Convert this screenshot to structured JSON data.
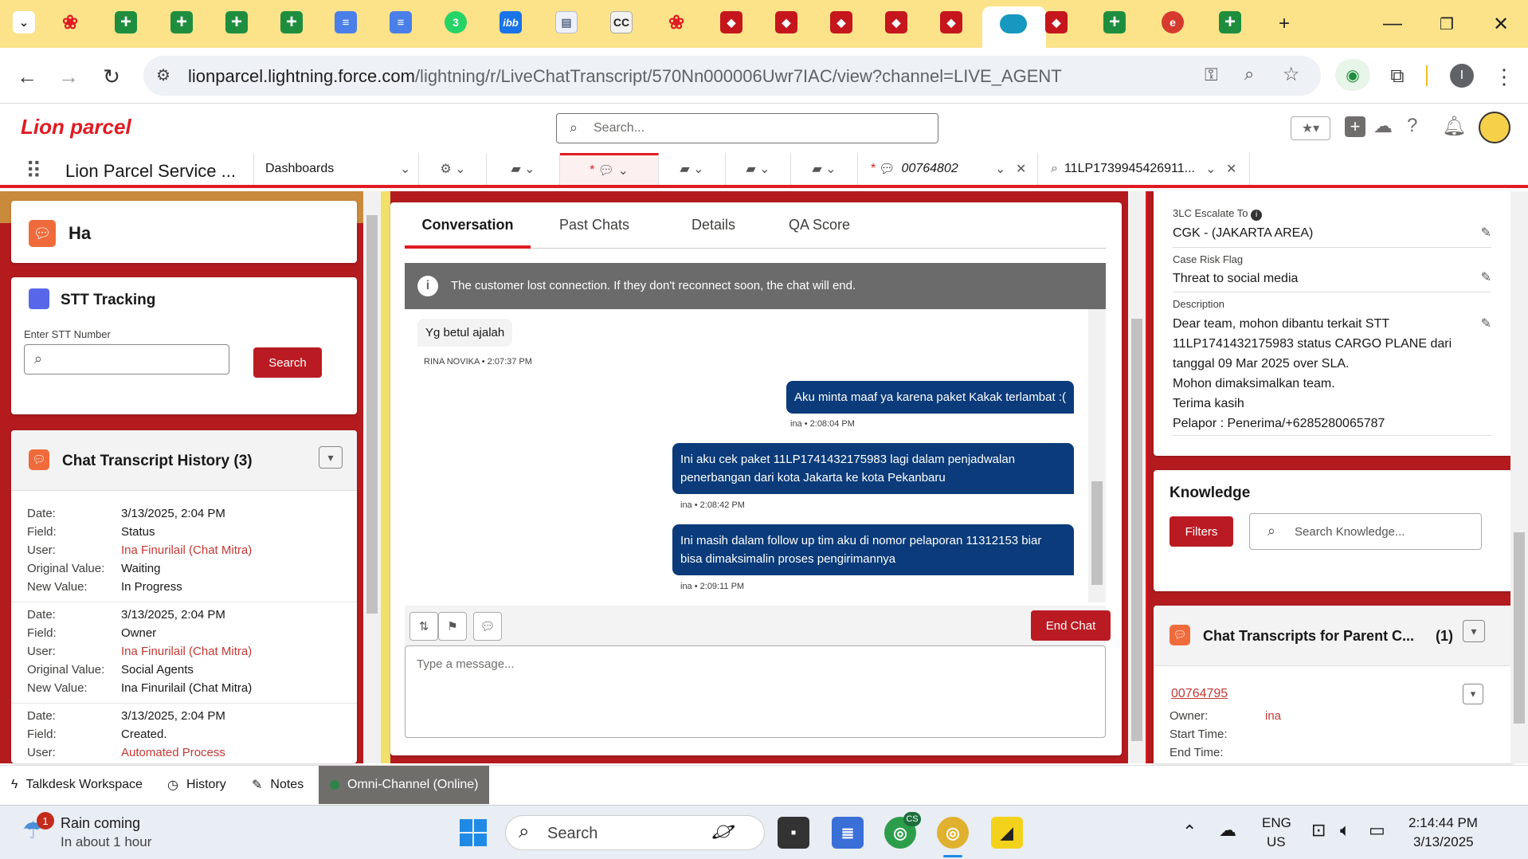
{
  "browser": {
    "url_host": "lionparcel.lightning.force.com",
    "url_path": "/lightning/r/LiveChatTranscript/570Nn000006Uwr7IAC/view?channel=LIVE_AGENT",
    "tab_glyphs": {
      "whatsapp": "3",
      "ibb": "ibb",
      "cc": "CC"
    }
  },
  "sf": {
    "logo": "Lion parcel",
    "search_placeholder": "Search...",
    "app_name": "Lion Parcel Service ...",
    "nav": {
      "dashboards": "Dashboards",
      "chat_tab_prefix": "*",
      "chat_tab_label": "00764802",
      "search_tab_label": "11LP1739945426911..."
    }
  },
  "left": {
    "ha_title": "Ha",
    "stt": {
      "title": "STT Tracking",
      "input_label": "Enter STT Number",
      "input_value": "",
      "search_button": "Search"
    },
    "history": {
      "title": "Chat Transcript History (3)",
      "labels": {
        "date": "Date:",
        "field": "Field:",
        "user": "User:",
        "orig": "Original Value:",
        "new": "New Value:"
      },
      "entries": [
        {
          "date": "3/13/2025, 2:04 PM",
          "field": "Status",
          "user": "Ina Finurilail (Chat Mitra)",
          "orig": "Waiting",
          "new": "In Progress"
        },
        {
          "date": "3/13/2025, 2:04 PM",
          "field": "Owner",
          "user": "Ina Finurilail (Chat Mitra)",
          "orig": "Social Agents",
          "new": "Ina Finurilail (Chat Mitra)"
        },
        {
          "date": "3/13/2025, 2:04 PM",
          "field": "Created.",
          "user": "Automated Process"
        }
      ]
    }
  },
  "center": {
    "tabs": [
      "Conversation",
      "Past Chats",
      "Details",
      "QA Score"
    ],
    "active_tab": "Conversation",
    "banner": "The customer lost connection. If they don't reconnect soon, the chat will end.",
    "messages": [
      {
        "dir": "in",
        "text": "Yg betul ajalah",
        "meta": "RINA NOVIKA • 2:07:37 PM"
      },
      {
        "dir": "out",
        "text": "Aku minta maaf ya karena paket Kakak terlambat :(",
        "meta": "ina • 2:08:04 PM"
      },
      {
        "dir": "out",
        "text": "Ini aku cek paket 11LP1741432175983 lagi dalam penjadwalan penerbangan dari kota Jakarta ke kota Pekanbaru",
        "meta": "ina • 2:08:42 PM"
      },
      {
        "dir": "out",
        "text": "Ini masih dalam follow up tim aku di nomor pelaporan 11312153 biar bisa dimaksimalin proses pengirimannya",
        "meta": "ina • 2:09:11 PM"
      }
    ],
    "end_chat": "End Chat",
    "composer_placeholder": "Type a message..."
  },
  "right": {
    "fields": [
      {
        "label": "3LC Escalate To",
        "value": "CGK - (JAKARTA AREA)"
      },
      {
        "label": "Case Risk Flag",
        "value": "Threat to social media"
      },
      {
        "label": "Description",
        "lines": [
          "Dear team, mohon dibantu terkait STT",
          "11LP1741432175983 status CARGO PLANE dari",
          "tanggal 09 Mar 2025 over SLA.",
          "Mohon dimaksimalkan team.",
          "Terima kasih",
          "Pelapor : Penerima/+6285280065787"
        ]
      }
    ],
    "knowledge": {
      "title": "Knowledge",
      "filters": "Filters",
      "search_placeholder": "Search Knowledge..."
    },
    "parent": {
      "title": "Chat Transcripts for Parent C...",
      "count": "(1)",
      "record": "00764795",
      "owner_label": "Owner:",
      "owner": "ina",
      "start_label": "Start Time:",
      "end_label": "End Time:"
    }
  },
  "utility": [
    "Talkdesk Workspace",
    "History",
    "Notes",
    "Omni-Channel (Online)"
  ],
  "taskbar": {
    "weather_title": "Rain coming",
    "weather_sub": "In about 1 hour",
    "weather_badge": "1",
    "search": "Search",
    "lang": "ENG",
    "region": "US",
    "time": "2:14:44 PM",
    "date": "3/13/2025",
    "chrome_badge": "CS"
  },
  "colors": {
    "brand": "#e01b22",
    "bubble": "#0b3b7a",
    "button": "#ba1b23",
    "banner": "#6b6b6b"
  }
}
